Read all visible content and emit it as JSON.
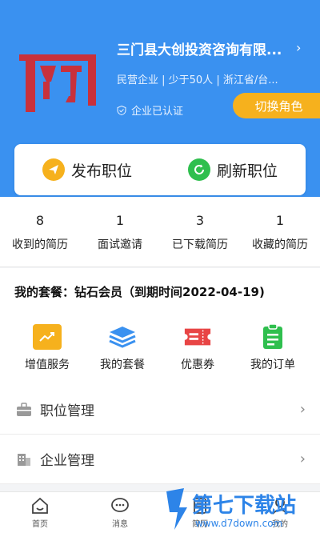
{
  "header": {
    "company_name": "三门县大创投资咨询有限...",
    "company_meta": "民营企业 | 少于50人 | 浙江省/台...",
    "verified_text": "企业已认证",
    "switch_role": "切换角色",
    "arrow": "›"
  },
  "actions": {
    "post_job": "发布职位",
    "refresh_job": "刷新职位"
  },
  "stats": [
    {
      "num": "8",
      "label": "收到的简历"
    },
    {
      "num": "1",
      "label": "面试邀请"
    },
    {
      "num": "3",
      "label": "已下载简历"
    },
    {
      "num": "1",
      "label": "收藏的简历"
    }
  ],
  "package": {
    "text": "我的套餐：钻石会员（到期时间2022-04-19)"
  },
  "tools": [
    {
      "label": "增值服务",
      "icon": "trending-up-icon",
      "color": "#f6b11d"
    },
    {
      "label": "我的套餐",
      "icon": "layers-icon",
      "color": "#3a91f0"
    },
    {
      "label": "优惠券",
      "icon": "coupon-icon",
      "color": "#e84545"
    },
    {
      "label": "我的订单",
      "icon": "clipboard-icon",
      "color": "#2fbf4e"
    }
  ],
  "list": [
    {
      "label": "职位管理",
      "icon": "briefcase-icon"
    },
    {
      "label": "企业管理",
      "icon": "building-icon"
    }
  ],
  "nav": [
    {
      "label": "首页",
      "icon": "home-icon"
    },
    {
      "label": "消息",
      "icon": "chat-icon"
    },
    {
      "label": "简历",
      "icon": "resume-icon"
    },
    {
      "label": "我的",
      "icon": "user-icon"
    }
  ],
  "watermark": {
    "title": "第七下载站",
    "url": "www.d7down.com"
  },
  "colors": {
    "primary": "#3a91f0",
    "accent": "#f6b11d",
    "green": "#2fbf4e",
    "red": "#e84545",
    "logo_red": "#c8313c"
  }
}
